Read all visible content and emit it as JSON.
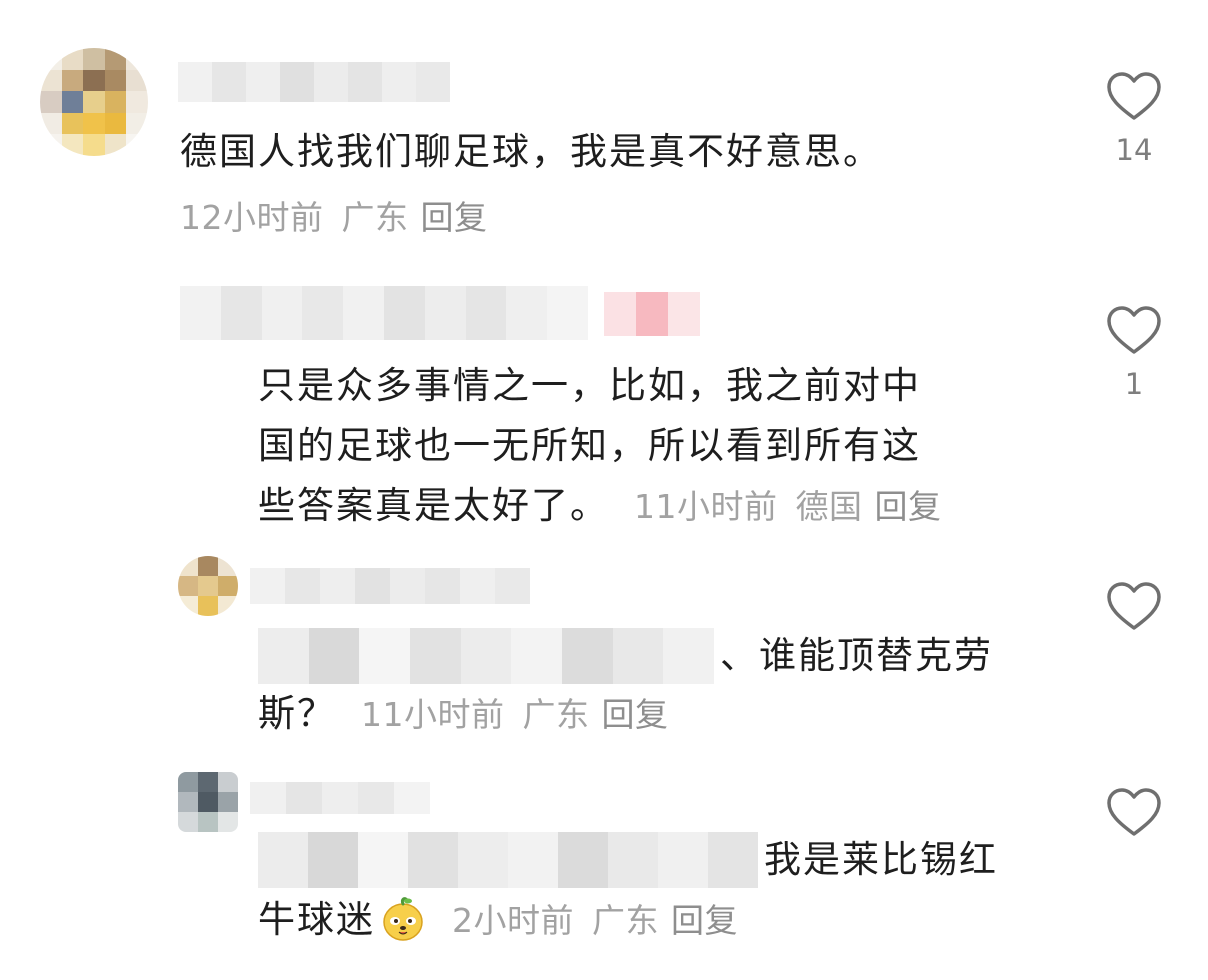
{
  "comments": [
    {
      "text": "德国人找我们聊足球，我是真不好意思。",
      "time": "12小时前",
      "location": "广东",
      "reply_label": "回复",
      "likes": "14",
      "liked": false,
      "icon": "heart-outline-icon"
    },
    {
      "lines": [
        "只是众多事情之一，比如，我之前对中",
        "国的足球也一无所知，所以看到所有这",
        "些答案真是太好了。"
      ],
      "time": "11小时前",
      "location": "德国",
      "reply_label": "回复",
      "likes": "1",
      "liked": false,
      "icon": "heart-outline-icon"
    },
    {
      "line1_tail": "、谁能顶替克劳",
      "line2": "斯？",
      "time": "11小时前",
      "location": "广东",
      "reply_label": "回复",
      "likes": "",
      "liked": false,
      "icon": "heart-outline-icon"
    },
    {
      "line1_tail": "我是莱比锡红",
      "line2": "牛球迷",
      "emoji": "lemon-dog-emoji",
      "time": "2小时前",
      "location": "广东",
      "reply_label": "回复",
      "likes": "",
      "liked": false,
      "icon": "heart-outline-icon"
    }
  ],
  "colors": {
    "text": "#1e1e1e",
    "meta": "#a2a2a2",
    "heart_stroke": "#6f6f6f"
  }
}
